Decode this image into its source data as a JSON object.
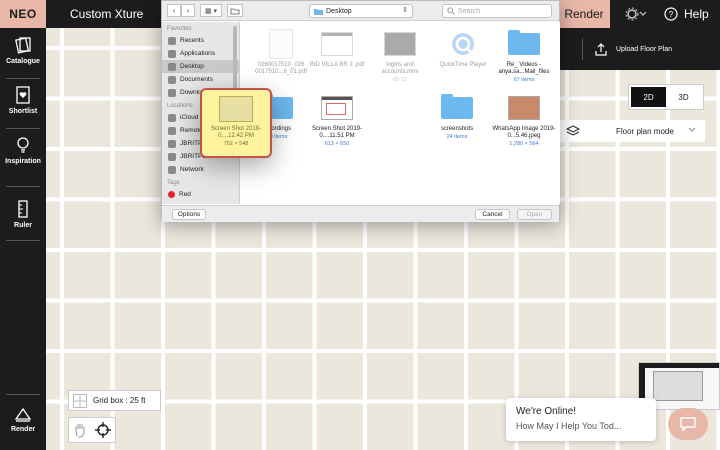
{
  "topbar": {
    "brand": "NEO",
    "project_title": "Custom Xture",
    "render_label": "Render",
    "help_label": "Help"
  },
  "sidebar": {
    "items": [
      {
        "label": "Catalogue",
        "icon": "catalogue-icon"
      },
      {
        "label": "Shortlist",
        "icon": "heart-shortlist-icon"
      },
      {
        "label": "Inspiration",
        "icon": "lightbulb-icon"
      },
      {
        "label": "Ruler",
        "icon": "ruler-icon"
      },
      {
        "label": "Render",
        "icon": "render-icon"
      }
    ]
  },
  "canvas": {
    "upload_label": "Upload Floor Plan",
    "view_toggle": {
      "options": [
        "2D",
        "3D"
      ],
      "active": "2D"
    },
    "mode_label": "Floor plan mode",
    "grid_label": "Grid box : 25 ft"
  },
  "chat": {
    "title": "We're Online!",
    "subtitle": "How May I Help You Tod..."
  },
  "dialog": {
    "location": "Desktop",
    "search_placeholder": "Search",
    "sidebar": {
      "favorites_header": "Favorites",
      "favorites": [
        "Recents",
        "Applications",
        "Desktop",
        "Documents",
        "Downloads"
      ],
      "selected": "Desktop",
      "locations_header": "Locations",
      "locations": [
        "iCloud Drive",
        "Remote Disc",
        "JBRITPLNAS",
        "JBRITPLNAS",
        "Network"
      ],
      "tags_header": "Tags",
      "tags": [
        "Red"
      ]
    },
    "files_row1": [
      {
        "name": "0260017510_026 0017510...6_01.pdf",
        "meta": "",
        "kind": "doc"
      },
      {
        "name": "IND VILLA BR 2 .pdf",
        "meta": "",
        "kind": "doc"
      },
      {
        "name": "logins and accounts.mov",
        "meta": "05:12",
        "kind": "video"
      },
      {
        "name": "QuickTime Player",
        "meta": "",
        "kind": "app"
      },
      {
        "name": "Re_ Videos - anya.sa...Mail_files",
        "meta": "67 items",
        "kind": "folder"
      }
    ],
    "files_row2": [
      {
        "name": "recordings",
        "meta": "50 items",
        "kind": "folder"
      },
      {
        "name": "Screen Shot 2019-0....11.51 PM",
        "meta": "613 × 650",
        "kind": "shot"
      },
      {
        "name": "Screen Shot 2019-0....12.42 PM",
        "meta": "752 × 548",
        "kind": "shot-selected"
      },
      {
        "name": "screenshots",
        "meta": "24 items",
        "kind": "folder"
      },
      {
        "name": "WhatsApp Image 2019-0...5.46.jpeg",
        "meta": "1,280 × 564",
        "kind": "image"
      }
    ],
    "options_label": "Options",
    "cancel_label": "Cancel",
    "open_label": "Open"
  }
}
